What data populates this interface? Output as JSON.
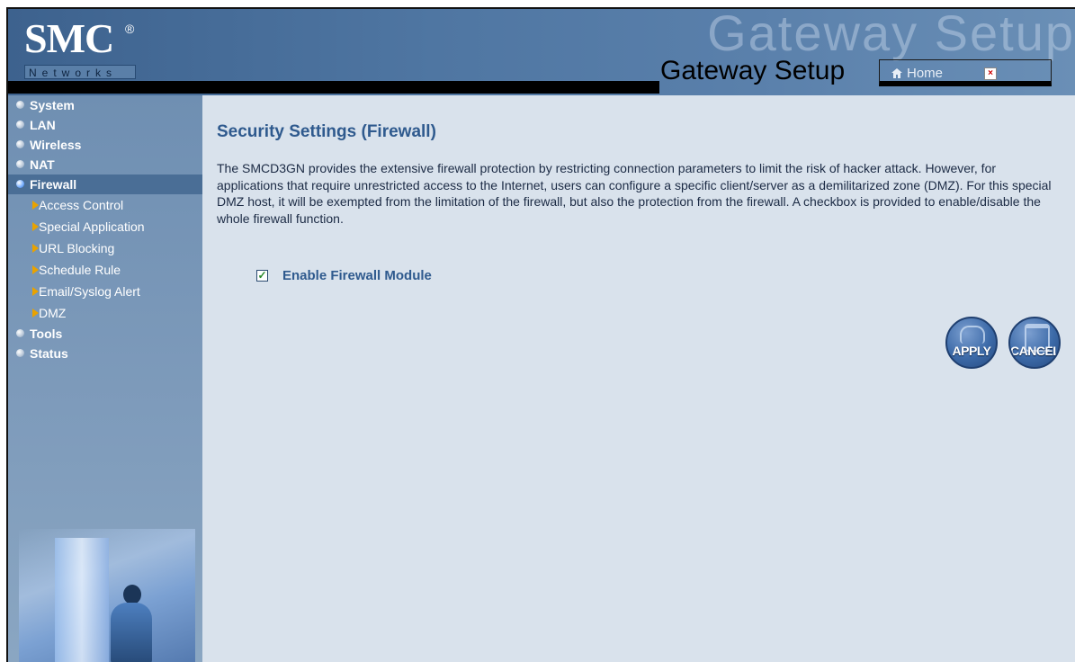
{
  "header": {
    "logo_text": "SMC",
    "logo_registered": "®",
    "logo_subtext": "Networks",
    "watermark": "Gateway Setup",
    "title": "Gateway Setup",
    "home_label": "Home",
    "close_glyph": "×"
  },
  "sidebar": {
    "items": [
      {
        "label": "System"
      },
      {
        "label": "LAN"
      },
      {
        "label": "Wireless"
      },
      {
        "label": "NAT"
      },
      {
        "label": "Firewall",
        "active": true
      },
      {
        "label": "Tools"
      },
      {
        "label": "Status"
      }
    ],
    "firewall_subitems": [
      {
        "label": "Access Control"
      },
      {
        "label": "Special Application"
      },
      {
        "label": "URL Blocking"
      },
      {
        "label": "Schedule Rule"
      },
      {
        "label": "Email/Syslog Alert"
      },
      {
        "label": "DMZ"
      }
    ]
  },
  "main": {
    "heading": "Security Settings (Firewall)",
    "description": "The SMCD3GN provides the extensive firewall protection by restricting connection parameters to limit the risk of hacker attack. However, for applications that require unrestricted access to the Internet, users can configure a specific client/server as a demilitarized zone (DMZ). For this special DMZ host, it will be exempted from the limitation of the firewall, but also the protection from the firewall. A checkbox is provided to enable/disable the whole firewall function.",
    "firewall_checkbox": {
      "label": "Enable Firewall Module",
      "checked": true,
      "check_glyph": "✓"
    },
    "apply_label": "APPLY",
    "cancel_label": "CANCEL"
  },
  "colors": {
    "header_bg": "#4f76a2",
    "sidebar_bg": "#7e9bbb",
    "active_item_bg": "#4a6e96",
    "content_bg": "#d9e2ec",
    "heading_color": "#2f5a8e",
    "submenu_arrow": "#e9a200"
  },
  "icons": [
    "home-icon",
    "close-icon",
    "nav-bullet-icon",
    "submenu-arrow-icon",
    "apply-icon",
    "cancel-icon"
  ]
}
